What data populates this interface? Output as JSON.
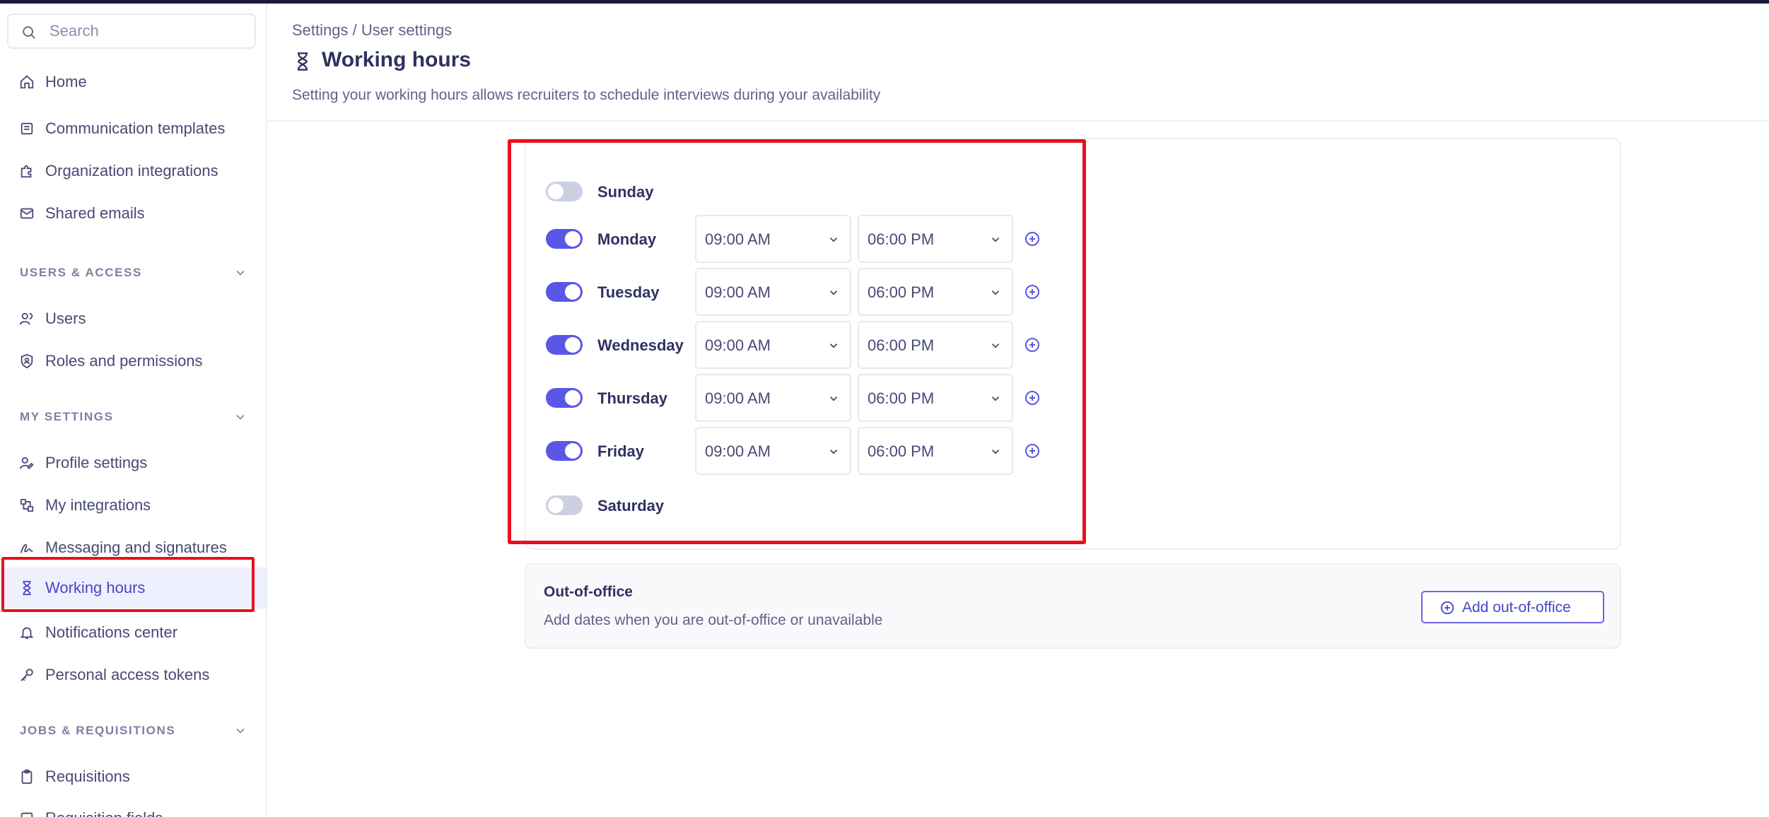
{
  "search": {
    "placeholder": "Search"
  },
  "sidebar": {
    "home": "Home",
    "settings_items": [
      "Communication templates",
      "Organization integrations",
      "Shared emails"
    ],
    "users_section": "USERS & ACCESS",
    "users_items": [
      "Users",
      "Roles and permissions"
    ],
    "my_settings_section": "MY SETTINGS",
    "my_settings_items": [
      "Profile settings",
      "My integrations",
      "Messaging and signatures",
      "Working hours",
      "Notifications center",
      "Personal access tokens"
    ],
    "jobs_section": "JOBS & REQUISITIONS",
    "jobs_items": [
      "Requisitions",
      "Requisition fields"
    ]
  },
  "header": {
    "breadcrumb": "Settings / User settings",
    "title": "Working hours",
    "subtitle": "Setting your working hours allows recruiters to schedule interviews during your availability"
  },
  "days": [
    {
      "name": "Sunday",
      "enabled": false,
      "start": "",
      "end": ""
    },
    {
      "name": "Monday",
      "enabled": true,
      "start": "09:00 AM",
      "end": "06:00 PM"
    },
    {
      "name": "Tuesday",
      "enabled": true,
      "start": "09:00 AM",
      "end": "06:00 PM"
    },
    {
      "name": "Wednesday",
      "enabled": true,
      "start": "09:00 AM",
      "end": "06:00 PM"
    },
    {
      "name": "Thursday",
      "enabled": true,
      "start": "09:00 AM",
      "end": "06:00 PM"
    },
    {
      "name": "Friday",
      "enabled": true,
      "start": "09:00 AM",
      "end": "06:00 PM"
    },
    {
      "name": "Saturday",
      "enabled": false,
      "start": "",
      "end": ""
    }
  ],
  "out_of_office": {
    "title": "Out-of-office",
    "description": "Add dates when you are out-of-office or unavailable",
    "button": "Add out-of-office"
  },
  "colors": {
    "accent": "#5b57e6",
    "highlight": "#e8101e",
    "toggle_off": "#cdcfe3"
  }
}
